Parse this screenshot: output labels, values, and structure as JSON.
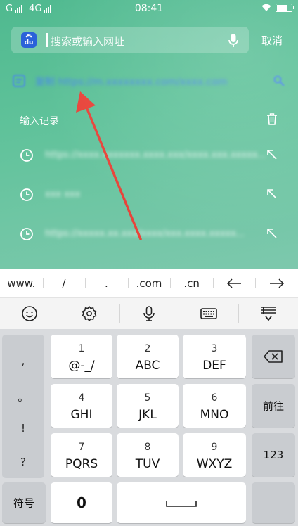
{
  "status_bar": {
    "network_left": "G",
    "network_right": "4G",
    "time": "08:41"
  },
  "search": {
    "placeholder": "搜索或输入网址",
    "cancel_label": "取消",
    "logo_text": "du"
  },
  "suggestion": {
    "text": "复制 https://m.xxxxxxxx.com/xxxx.com"
  },
  "history": {
    "title": "输入记录",
    "items": [
      {
        "text": "https://xxxx.xxxxxxx.xxxx.xxx/xxxx.xxx.xxxxx..."
      },
      {
        "text": "xxx xxx"
      },
      {
        "text": "https://xxxxx.xx.xxx/xxxx/xxx.xxxx.xxxxx..."
      }
    ]
  },
  "shortcuts": [
    "www.",
    "/",
    ".",
    ".com",
    ".cn"
  ],
  "toolbar_icons": [
    "emoji-icon",
    "settings-icon",
    "mic-icon",
    "keyboard-icon",
    "collapse-keyboard-icon"
  ],
  "keyboard": {
    "punctuation": [
      ",",
      "。",
      "!",
      "?"
    ],
    "keys": [
      {
        "num": "1",
        "letters": "@-_/"
      },
      {
        "num": "2",
        "letters": "ABC"
      },
      {
        "num": "3",
        "letters": "DEF"
      },
      {
        "num": "4",
        "letters": "GHI"
      },
      {
        "num": "5",
        "letters": "JKL"
      },
      {
        "num": "6",
        "letters": "MNO"
      },
      {
        "num": "7",
        "letters": "PQRS"
      },
      {
        "num": "8",
        "letters": "TUV"
      },
      {
        "num": "9",
        "letters": "WXYZ"
      }
    ],
    "next_label": "前往",
    "num_label": "123",
    "symbol_label": "符号",
    "zero_label": "0"
  },
  "colors": {
    "accent_link": "#4a86ef",
    "annotation_arrow": "#e8443a",
    "baidu_blue": "#2b62d9"
  }
}
